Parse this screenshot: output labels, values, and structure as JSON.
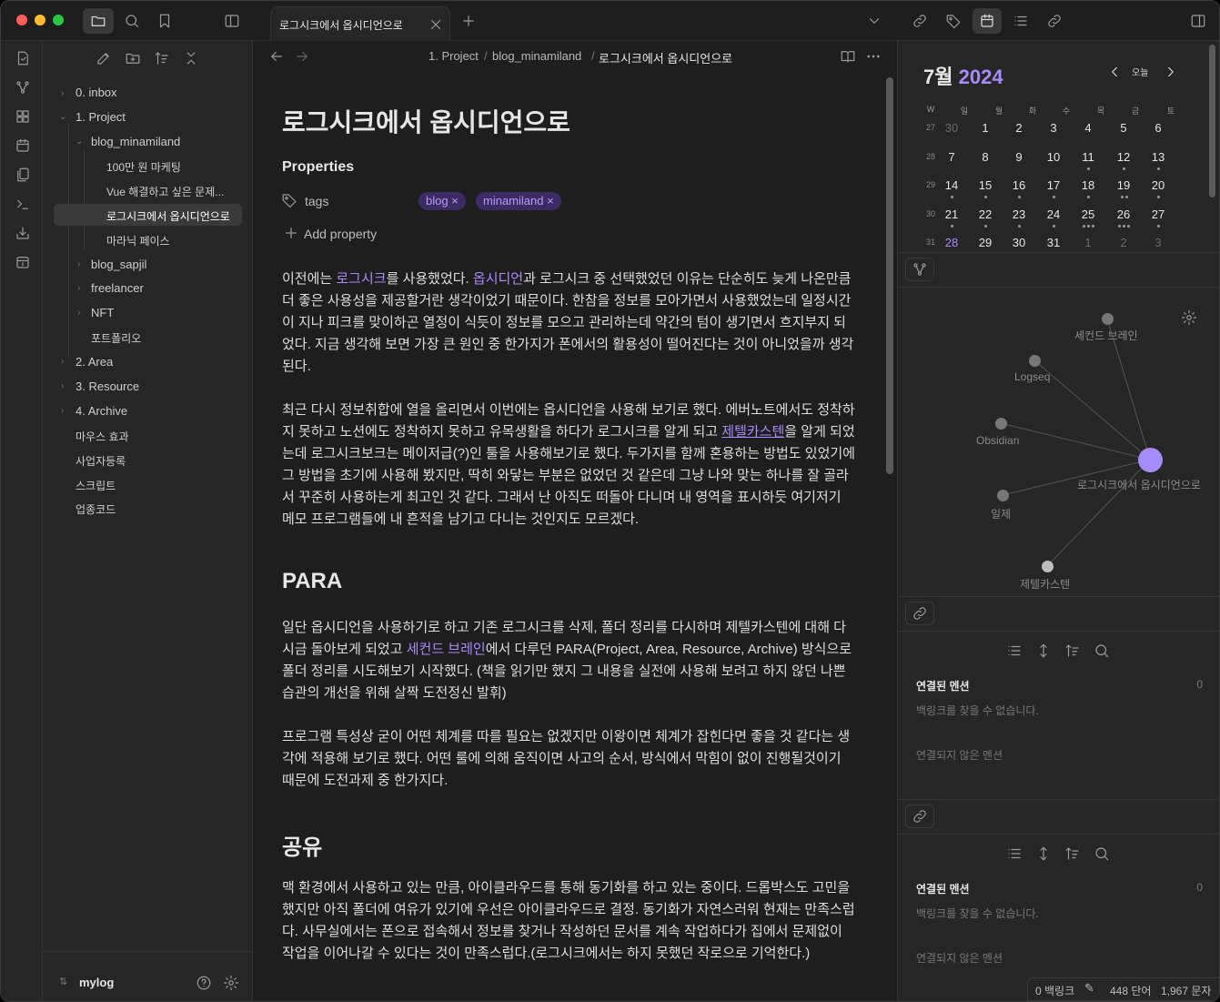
{
  "titlebar": {
    "tab_title": "로그시크에서 옵시디언으로"
  },
  "sidebar": {
    "items": [
      {
        "label": "0. inbox"
      },
      {
        "label": "1. Project"
      },
      {
        "label": "blog_minamiland"
      },
      {
        "label": "100만 원 마케팅"
      },
      {
        "label": "Vue 해결하고 싶은 문제..."
      },
      {
        "label": "로그시크에서 옵시디언으로"
      },
      {
        "label": "마라닉 페이스"
      },
      {
        "label": "blog_sapjil"
      },
      {
        "label": "freelancer"
      },
      {
        "label": "NFT"
      },
      {
        "label": "포트폴리오"
      },
      {
        "label": "2. Area"
      },
      {
        "label": "3. Resource"
      },
      {
        "label": "4. Archive"
      },
      {
        "label": "마우스 효과"
      },
      {
        "label": "사업자등록"
      },
      {
        "label": "스크립트"
      },
      {
        "label": "업종코드"
      }
    ],
    "vault_name": "mylog"
  },
  "breadcrumb": {
    "part1": "1. Project",
    "sep": "/",
    "part2": "blog_minamiland",
    "part3": "로그시크에서 옵시디언으로"
  },
  "doc": {
    "title": "로그시크에서 옵시디언으로",
    "properties_label": "Properties",
    "tags_label": "tags",
    "tags": [
      "blog",
      "minamiland"
    ],
    "add_property": "Add property",
    "p1a": "이전에는 ",
    "p1_link1": "로그시크",
    "p1b": "를 사용했었다. ",
    "p1_link2": "옵시디언",
    "p1c": "과 로그시크 중 선택했었던 이유는 단순히도 늦게 나온만큼 더 좋은 사용성을 제공할거란 생각이었기 때문이다. 한참을 정보를 모아가면서 사용했었는데 일정시간이 지나 피크를 맞이하곤 열정이 식듯이 정보를 모으고 관리하는데 약간의 텀이 생기면서 흐지부지 되었다. 지금 생각해 보면 가장 큰 원인 중 한가지가 폰에서의 활용성이 떨어진다는 것이 아니었을까 생각된다.",
    "p2a": "최근 다시 정보취합에 열을 올리면서 이번에는 옵시디언을 사용해 보기로 했다. 에버노트에서도 정착하지 못하고 노션에도 정착하지 못하고 유목생활을 하다가 로그시크를 알게 되고 ",
    "p2_link": "제텔카스텐",
    "p2b": "을 알게 되었는데 로그시크보크는 메이저급(?)인 툴을 사용해보기로 했다. 두가지를 함께 혼용하는 방법도 있었기에 그 방법을 초기에 사용해 봤지만, 딱히 와닿는 부분은 없었던 것 같은데 그냥 나와 맞는 하나를 잘 골라서 꾸준히 사용하는게 최고인 것 같다. 그래서 난 아직도 떠돌아 다니며 내 영역을 표시하듯 여기저기 메모 프로그램들에 내 흔적을 남기고 다니는 것인지도 모르겠다.",
    "h_para": "PARA",
    "p3a": "일단 옵시디언을 사용하기로 하고 기존 로그시크를 삭제, 폴더 정리를 다시하며 제텔카스텐에 대해 다시금 돌아보게 되었고 ",
    "p3_link": "세컨드 브레인",
    "p3b": "에서 다루던 PARA(Project, Area, Resource, Archive) 방식으로 폴더 정리를 시도해보기 시작했다. (책을 읽기만 했지 그 내용을 실전에 사용해 보려고 하지 않던 나쁜 습관의 개선을 위해 살짝 도전정신 발휘)",
    "p4": "프로그램 특성상 굳이 어떤 체계를 따를 필요는 없겠지만 이왕이면 체계가 잡힌다면 좋을 것 같다는 생각에 적용해 보기로 했다. 어떤 룰에 의해 움직이면 사고의 순서, 방식에서 막힘이 없이 진행될것이기 때문에 도전과제 중 한가지다.",
    "h_share": "공유",
    "p5": "맥 환경에서 사용하고 있는 만큼, 아이클라우드를 통해 동기화를 하고 있는 중이다. 드롭박스도 고민을 했지만 아직 폴더에 여유가 있기에 우선은 아이클라우드로 결정. 동기화가 자연스러워 현재는 만족스럽다. 사무실에서는 폰으로 접속해서 정보를 찾거나 작성하던 문서를 계속 작업하다가 집에서 문제없이 작업을 이어나갈 수 있다는 것이 만족스럽다.(로그시크에서는 하지 못했던 작로으로 기억한다.)"
  },
  "calendar": {
    "month": "7월",
    "year": "2024",
    "today_btn": "오늘",
    "dow": [
      "W",
      "일",
      "월",
      "화",
      "수",
      "목",
      "금",
      "토"
    ],
    "weeks": [
      {
        "wk": "27",
        "days": [
          "30",
          "1",
          "2",
          "3",
          "4",
          "5",
          "6"
        ]
      },
      {
        "wk": "28",
        "days": [
          "7",
          "8",
          "9",
          "10",
          "11",
          "12",
          "13"
        ]
      },
      {
        "wk": "29",
        "days": [
          "14",
          "15",
          "16",
          "17",
          "18",
          "19",
          "20"
        ]
      },
      {
        "wk": "30",
        "days": [
          "21",
          "22",
          "23",
          "24",
          "25",
          "26",
          "27"
        ]
      },
      {
        "wk": "31",
        "days": [
          "28",
          "29",
          "30",
          "31",
          "1",
          "2",
          "3"
        ]
      }
    ]
  },
  "graph": {
    "nodes": [
      {
        "label": "세컨드 브레인"
      },
      {
        "label": "Logseq"
      },
      {
        "label": "Obsidian"
      },
      {
        "label": "로그시크에서 옵시디언으로"
      },
      {
        "label": "일제"
      },
      {
        "label": "제텔카스텐"
      }
    ]
  },
  "backlinks1": {
    "title": "연결된 멘션",
    "count": "0",
    "empty": "백링크를 찾을 수 없습니다.",
    "unlinked": "연결되지 않은 멘션"
  },
  "backlinks2": {
    "title": "연결된 멘션",
    "count": "0",
    "empty": "백링크를 찾을 수 없습니다.",
    "unlinked": "연결되지 않은 멘션"
  },
  "status": {
    "backlinks": "0 백링크",
    "words": "448 단어",
    "chars": "1,967 문자"
  },
  "colors": {
    "accent": "#a88bfa",
    "bg": "#1e1e1e",
    "panel": "#262626"
  }
}
